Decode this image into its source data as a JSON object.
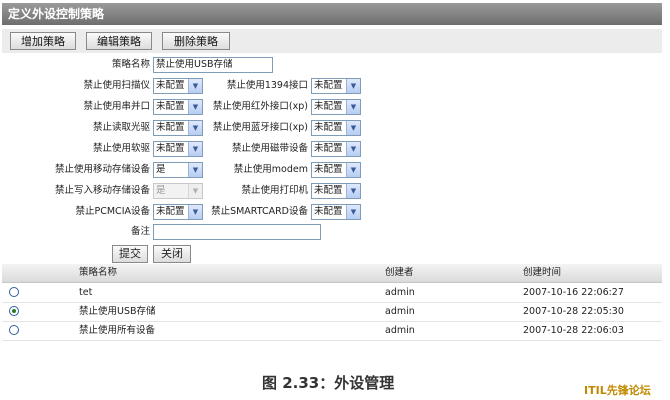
{
  "window_title": "定义外设控制策略",
  "toolbar": {
    "add": "增加策略",
    "edit": "编辑策略",
    "delete": "删除策略"
  },
  "form": {
    "policy_name_label": "策略名称",
    "policy_name_value": "禁止使用USB存储",
    "fields": [
      {
        "label": "禁止使用扫描仪",
        "value": "未配置"
      },
      {
        "label": "禁止使用1394接口",
        "value": "未配置"
      },
      {
        "label": "禁止使用串并口",
        "value": "未配置"
      },
      {
        "label": "禁止使用红外接口(xp)",
        "value": "未配置"
      },
      {
        "label": "禁止读取光驱",
        "value": "未配置"
      },
      {
        "label": "禁止使用蓝牙接口(xp)",
        "value": "未配置"
      },
      {
        "label": "禁止使用软驱",
        "value": "未配置"
      },
      {
        "label": "禁止使用磁带设备",
        "value": "未配置"
      },
      {
        "label": "禁止使用移动存储设备",
        "value": "是"
      },
      {
        "label": "禁止使用modem",
        "value": "未配置"
      },
      {
        "label": "禁止写入移动存储设备",
        "value": "是"
      },
      {
        "label": "禁止使用打印机",
        "value": "未配置"
      },
      {
        "label": "禁止PCMCIA设备",
        "value": "未配置"
      },
      {
        "label": "禁止SMARTCARD设备",
        "value": "未配置"
      }
    ],
    "note_label": "备注",
    "note_value": "",
    "submit": "提交",
    "close": "关闭"
  },
  "table": {
    "columns": [
      "策略名称",
      "创建者",
      "创建时间"
    ],
    "rows": [
      {
        "selected": false,
        "name": "tet",
        "creator": "admin",
        "time": "2007-10-16 22:06:27"
      },
      {
        "selected": true,
        "name": "禁止使用USB存储",
        "creator": "admin",
        "time": "2007-10-28 22:05:30"
      },
      {
        "selected": false,
        "name": "禁止使用所有设备",
        "creator": "admin",
        "time": "2007-10-28 22:06:03"
      }
    ]
  },
  "caption": "图 2.33：外设管理",
  "watermark": "ITIL先锋论坛",
  "icons": {
    "dropdown": "chevron-down-icon",
    "radio": "radio-icon"
  }
}
